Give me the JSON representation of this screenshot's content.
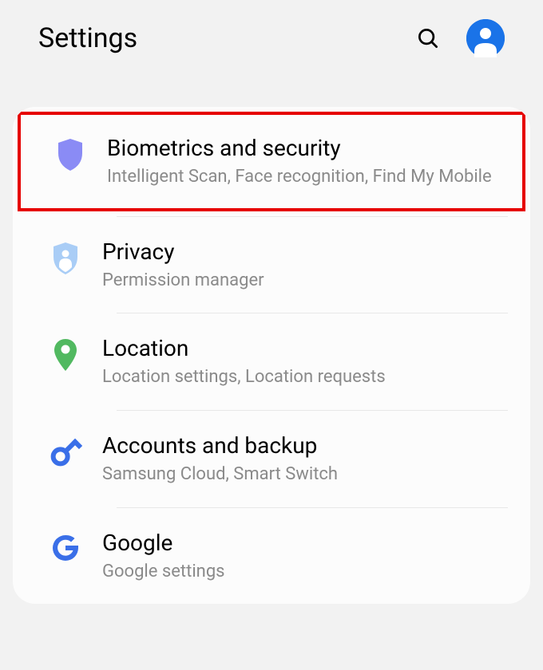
{
  "header": {
    "title": "Settings"
  },
  "items": [
    {
      "title": "Biometrics and security",
      "subtitle": "Intelligent Scan, Face recognition, Find My Mobile",
      "highlighted": true
    },
    {
      "title": "Privacy",
      "subtitle": "Permission manager"
    },
    {
      "title": "Location",
      "subtitle": "Location settings, Location requests"
    },
    {
      "title": "Accounts and backup",
      "subtitle": "Samsung Cloud, Smart Switch"
    },
    {
      "title": "Google",
      "subtitle": "Google settings"
    }
  ]
}
